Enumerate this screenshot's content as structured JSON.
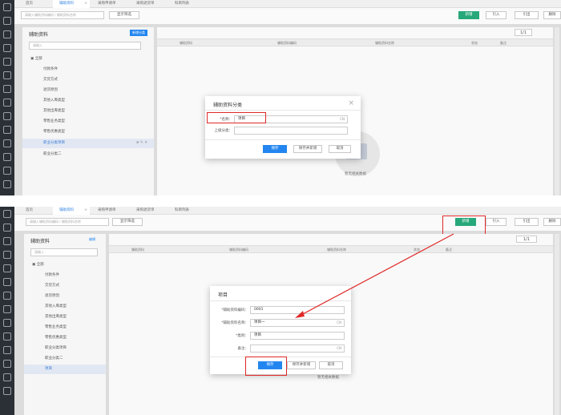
{
  "tabs": {
    "home": "首页",
    "aux": "辅助资料",
    "purchase_request": "采购申请单",
    "purchase_return": "采购退货单",
    "account_list": "科目列表"
  },
  "toolbar": {
    "search_placeholder": "请输入辅助资料编码 / 辅助资料名称",
    "filter": "显示筛选",
    "add": "新增",
    "import": "引入",
    "export": "引出",
    "delete": "删除"
  },
  "tree": {
    "title": "辅助资料",
    "add_category": "新增分类",
    "edit": "编辑",
    "search_placeholder": "请输入",
    "root": "全部",
    "items_top": [
      "付款条件",
      "交货方式",
      "退货原因",
      "其他入库类型",
      "其他出库类型",
      "零售业务类型",
      "零售优惠类型",
      "职业分类项目",
      "职业分类二"
    ],
    "items_bottom": [
      "付款条件",
      "交货方式",
      "退货原因",
      "其他入库类型",
      "其他出库类型",
      "零售业务类型",
      "零售优惠类型",
      "职业分类项目",
      "职业分类二",
      "项目"
    ]
  },
  "grid": {
    "columns": [
      "辅助资料",
      "辅助资料编码",
      "辅助资料名称",
      "状态",
      "备注"
    ],
    "page": "1/1",
    "empty": "暂无相关数据"
  },
  "dialog_top": {
    "title": "辅助资料分类",
    "name_label": "*名称：",
    "name_value": "项目",
    "parent_label": "上级分类：",
    "parent_value": "",
    "cn": "CN",
    "save": "保存",
    "save_new": "保存并新增",
    "cancel": "取消"
  },
  "dialog_bottom": {
    "title": "项目",
    "code_label": "*辅助资料编码：",
    "code_value": "0001",
    "name_label": "*辅助资料名称：",
    "name_value": "项目一",
    "category_label": "*类别：",
    "category_value": "项目",
    "remark_label": "备注：",
    "remark_value": "",
    "cn": "CN",
    "save": "保存",
    "save_new": "保存并新增",
    "cancel": "取消"
  },
  "colors": {
    "accent_blue": "#2386f0",
    "add_green": "#27a87a",
    "highlight_red": "#e02828",
    "sidebar": "#2b2f36"
  }
}
